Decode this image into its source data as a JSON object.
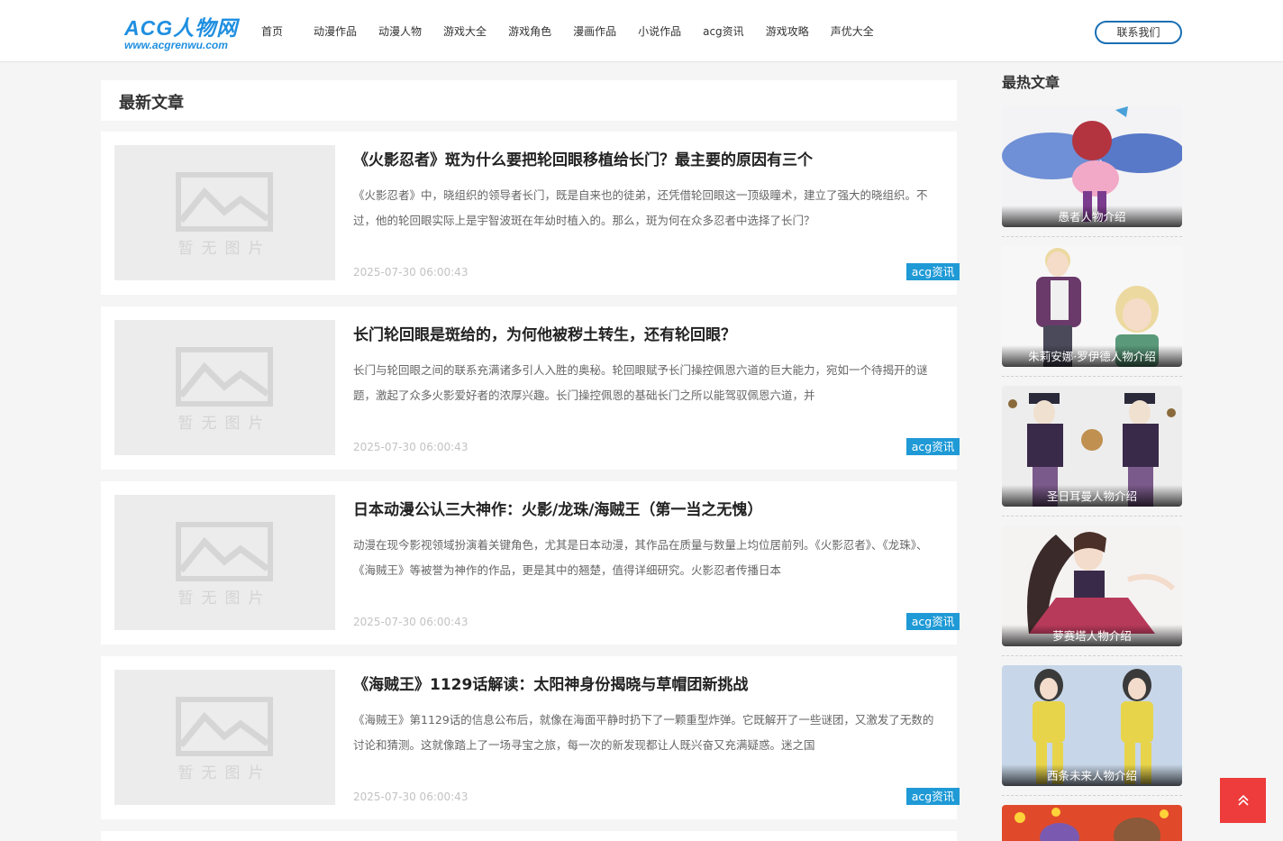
{
  "header": {
    "logo_main": "ACG人物网",
    "logo_sub": "www.acgrenwu.com",
    "nav": [
      "首页",
      "动漫作品",
      "动漫人物",
      "游戏大全",
      "游戏角色",
      "漫画作品",
      "小说作品",
      "acg资讯",
      "游戏攻略",
      "声优大全"
    ],
    "contact_label": "联系我们"
  },
  "main": {
    "section_title": "最新文章",
    "placeholder_text": "暂无图片",
    "articles": [
      {
        "title": "《火影忍者》斑为什么要把轮回眼移植给长门？最主要的原因有三个",
        "desc": "《火影忍者》中，晓组织的领导者长门，既是自来也的徒弟，还凭借轮回眼这一顶级瞳术，建立了强大的晓组织。不过，他的轮回眼实际上是宇智波斑在年幼时植入的。那么，斑为何在众多忍者中选择了长门？",
        "date": "2025-07-30 06:00:43",
        "tag": "acg资讯"
      },
      {
        "title": "长门轮回眼是斑给的，为何他被秽土转生，还有轮回眼？",
        "desc": "长门与轮回眼之间的联系充满诸多引人入胜的奥秘。轮回眼赋予长门操控佩恩六道的巨大能力，宛如一个待揭开的谜题，激起了众多火影爱好者的浓厚兴趣。长门操控佩恩的基础长门之所以能驾驭佩恩六道，并",
        "date": "2025-07-30 06:00:43",
        "tag": "acg资讯"
      },
      {
        "title": "日本动漫公认三大神作：火影/龙珠/海贼王（第一当之无愧）",
        "desc": "动漫在现今影视领域扮演着关键角色，尤其是日本动漫，其作品在质量与数量上均位居前列。《火影忍者》、《龙珠》、《海贼王》等被誉为神作的作品，更是其中的翘楚，值得详细研究。火影忍者传播日本",
        "date": "2025-07-30 06:00:43",
        "tag": "acg资讯"
      },
      {
        "title": "《海贼王》1129话解读：太阳神身份揭晓与草帽团新挑战",
        "desc": "《海贼王》第1129话的信息公布后，就像在海面平静时扔下了一颗重型炸弹。它既解开了一些谜团，又激发了无数的讨论和猜测。这就像踏上了一场寻宝之旅，每一次的新发现都让人既兴奋又充满疑惑。迷之国",
        "date": "2025-07-30 06:00:43",
        "tag": "acg资讯"
      }
    ]
  },
  "sidebar": {
    "title": "最热文章",
    "items": [
      {
        "caption": "愚者人物介绍"
      },
      {
        "caption": "朱莉安娜·罗伊德人物介绍"
      },
      {
        "caption": "圣日耳曼人物介绍"
      },
      {
        "caption": "萝赛塔人物介绍"
      },
      {
        "caption": "西条未来人物介绍"
      },
      {
        "caption": ""
      }
    ]
  },
  "to_top_icon": "double-chevron-up-icon",
  "colors": {
    "accent": "#1f9ad6",
    "logo": "#1f8fe0",
    "to_top": "#ee3b3b",
    "contact_border": "#1a6fb4"
  }
}
